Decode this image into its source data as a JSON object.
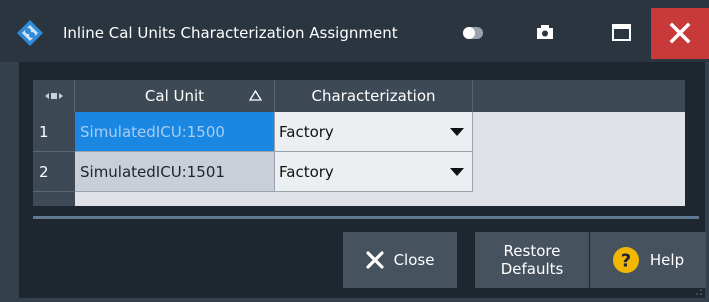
{
  "window": {
    "title": "Inline Cal Units Characterization Assignment",
    "accent": "#1a88e2",
    "close_color": "#c8393a"
  },
  "table": {
    "columns": [
      "Cal Unit",
      "Characterization"
    ],
    "rows": [
      {
        "num": "1",
        "cal_unit": "SimulatedICU:1500",
        "characterization": "Factory",
        "selected": true
      },
      {
        "num": "2",
        "cal_unit": "SimulatedICU:1501",
        "characterization": "Factory",
        "selected": false
      }
    ]
  },
  "buttons": {
    "close": "Close",
    "restore_line1": "Restore",
    "restore_line2": "Defaults",
    "help": "Help"
  },
  "icons": {
    "app": "app-logo-icon",
    "titlebar": [
      "toggle-icon",
      "camera-icon",
      "maximize-icon",
      "close-icon"
    ],
    "sort": "sort-ascending-icon",
    "dropdown": "dropdown-arrow-icon",
    "help": "help-question-icon"
  }
}
